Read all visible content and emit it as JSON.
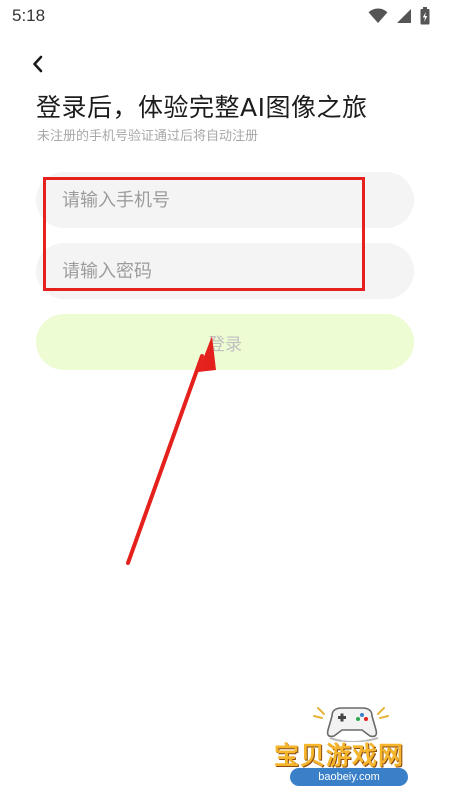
{
  "status_bar": {
    "time": "5:18",
    "icons": [
      "wifi-icon",
      "cellular-signal-icon",
      "battery-icon"
    ]
  },
  "header": {
    "back_icon": "chevron-left-icon",
    "title": "登录后，体验完整AI图像之旅",
    "subtitle": "未注册的手机号验证通过后将自动注册"
  },
  "form": {
    "phone_placeholder": "请输入手机号",
    "phone_value": "",
    "password_placeholder": "请输入密码",
    "password_value": "",
    "login_label": "登录"
  },
  "annotation": {
    "color": "#e4211c",
    "type": "red highlight box and arrow pointing to login button"
  },
  "watermark": {
    "text": "宝贝游戏网",
    "url": "baobeiy.com"
  },
  "colors": {
    "accent_light": "#eefcd3",
    "input_bg": "#f4f4f4",
    "annotation_red": "#e4211c"
  }
}
